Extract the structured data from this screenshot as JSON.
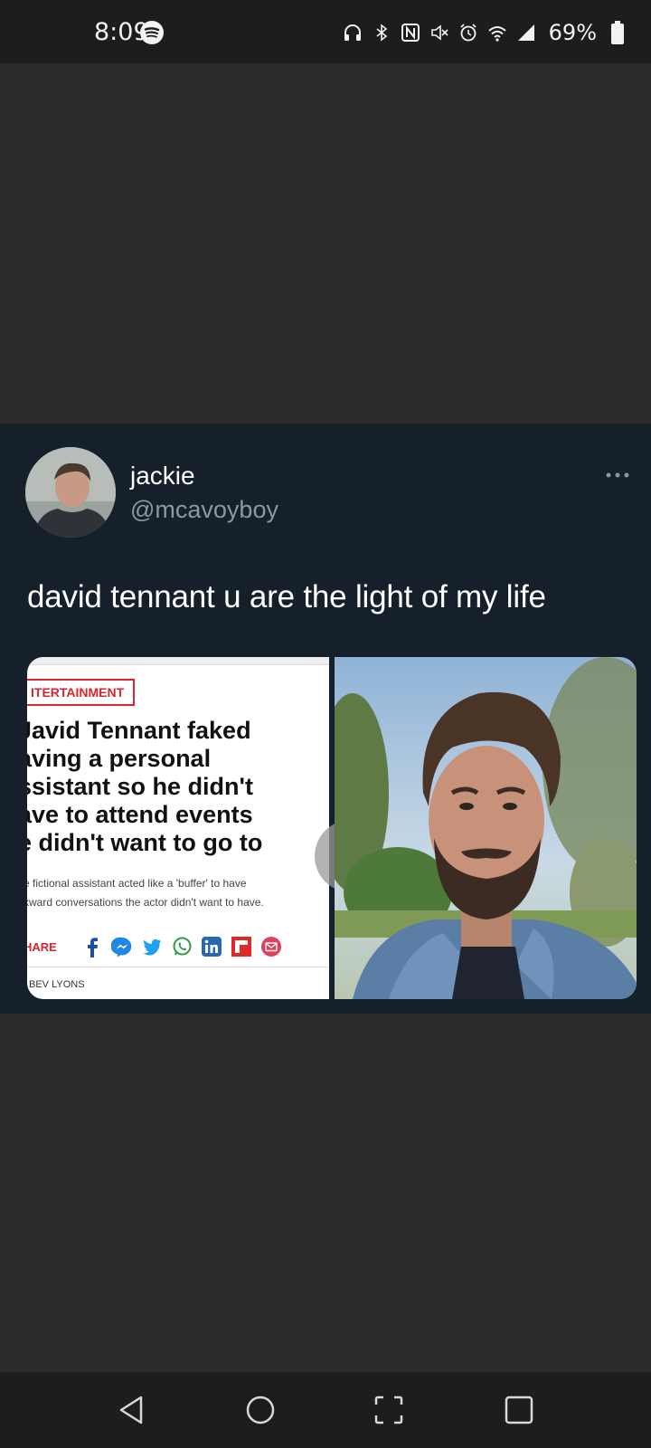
{
  "status_bar": {
    "time": "8:09",
    "battery_percent": "69%",
    "icons": [
      "spotify-icon",
      "headphones-icon",
      "bluetooth-icon",
      "nfc-icon",
      "mute-icon",
      "alarm-icon",
      "wifi-icon",
      "signal-icon",
      "battery-icon"
    ]
  },
  "tweet": {
    "display_name": "jackie",
    "handle": "@mcavoyboy",
    "text": "david tennant u are the light of my life",
    "more_icon": "more-horizontal-icon",
    "media": {
      "article": {
        "tag": "ITERTAINMENT",
        "headline": "Javid Tennant faked\naving a personal\nssistant so he didn't\nave to attend events\ne didn't want to go to",
        "summary": "e fictional assistant acted like a 'buffer' to have\nkward conversations the actor didn't want to have.",
        "share_label": "HARE",
        "share_icons": [
          "facebook-icon",
          "messenger-icon",
          "twitter-icon",
          "whatsapp-icon",
          "linkedin-icon",
          "flipboard-icon",
          "email-icon"
        ],
        "author": "BEV LYONS"
      },
      "photo": "portrait-photo"
    }
  },
  "nav_bar": {
    "buttons": [
      "back-icon",
      "home-icon",
      "screenshot-icon",
      "recents-icon"
    ]
  },
  "colors": {
    "page_background": "#2d2a2e",
    "card_background": "#15202b",
    "handle_color": "#8899a6",
    "accent_red": "#d8262d"
  }
}
